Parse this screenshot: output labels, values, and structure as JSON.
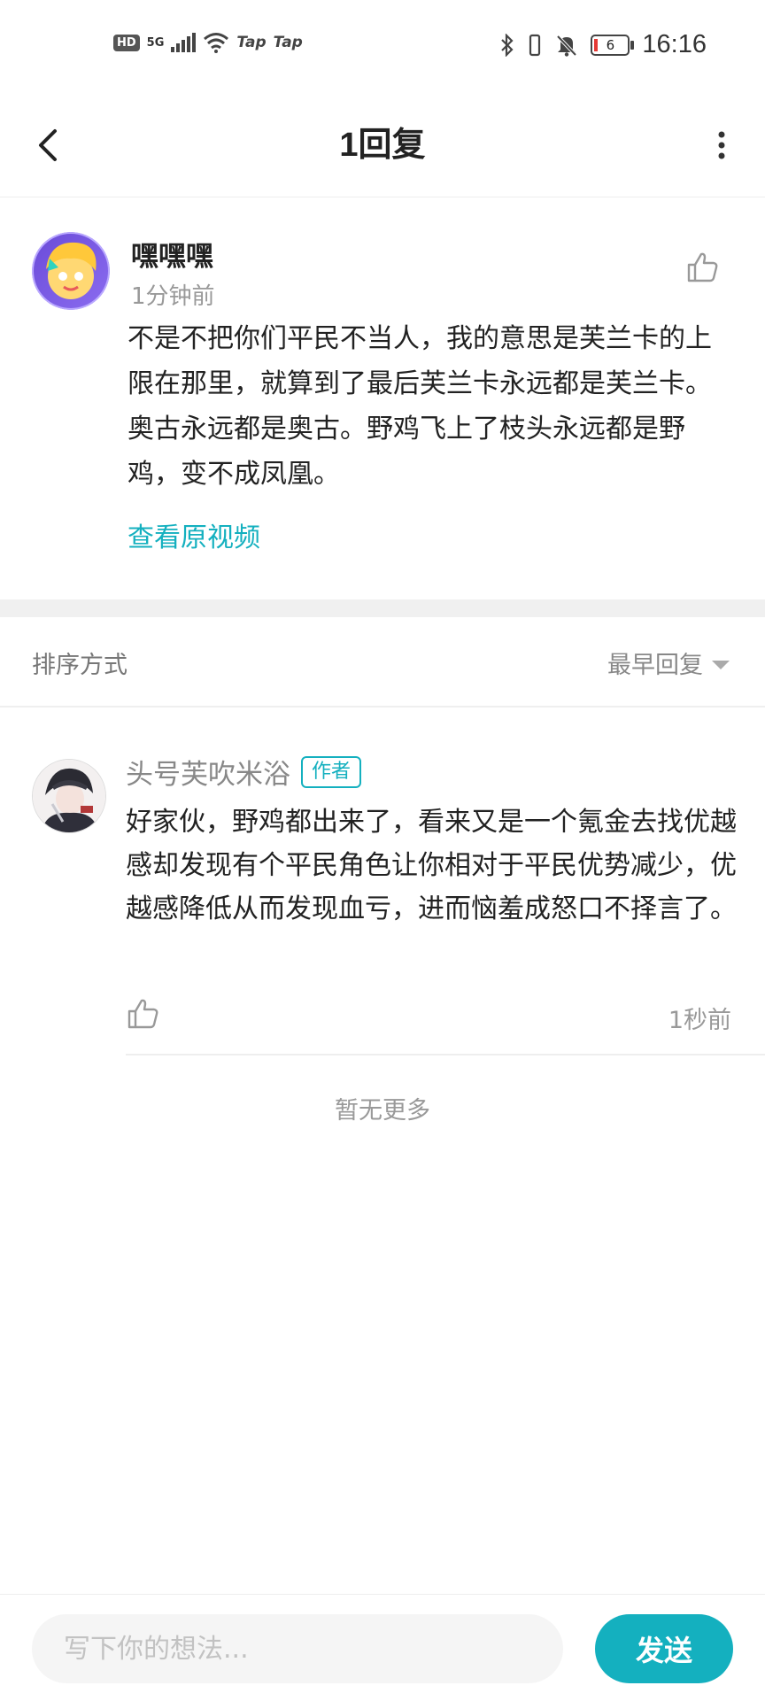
{
  "status_bar": {
    "left_badges": [
      "HD",
      "5G",
      "Tap",
      "Tap"
    ],
    "battery_level": "6",
    "time": "16:16"
  },
  "header": {
    "title": "1回复"
  },
  "main_comment": {
    "author": "嘿嘿嘿",
    "time_ago": "1分钟前",
    "text": "不是不把你们平民不当人，我的意思是芙兰卡的上限在那里，就算到了最后芙兰卡永远都是芙兰卡。奥古永远都是奥古。野鸡飞上了枝头永远都是野鸡，变不成凤凰。",
    "view_video_label": "查看原视频"
  },
  "sort": {
    "label": "排序方式",
    "value": "最早回复"
  },
  "reply": {
    "author": "头号芙吹米浴",
    "badge": "作者",
    "text": "好家伙，野鸡都出来了，看来又是一个氪金去找优越感却发现有个平民角色让你相对于平民优势减少，优越感降低从而发现血亏，进而恼羞成怒口不择言了。",
    "time_ago": "1秒前"
  },
  "no_more_label": "暂无更多",
  "bottom": {
    "input_placeholder": "写下你的想法...",
    "send_label": "发送"
  },
  "colors": {
    "accent": "#14b0bf",
    "battery_low": "#e53935"
  },
  "icons": [
    "back-arrow-icon",
    "more-vertical-icon",
    "thumbs-up-icon",
    "dropdown-caret-icon",
    "bluetooth-icon",
    "vibrate-icon",
    "mute-bell-icon",
    "wifi-icon",
    "signal-icon"
  ]
}
